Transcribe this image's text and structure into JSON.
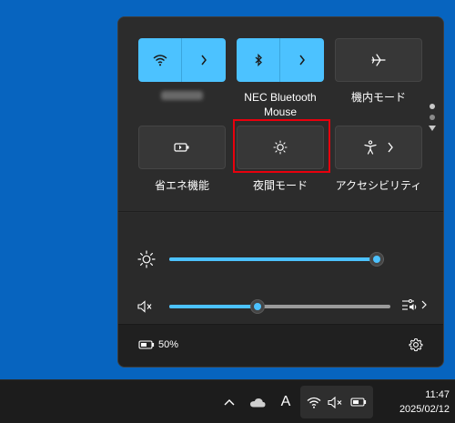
{
  "quick_settings": {
    "tiles_row1": [
      {
        "id": "wifi",
        "icon": "wifi-icon",
        "label": "",
        "active": true,
        "split": true
      },
      {
        "id": "bluetooth",
        "icon": "bluetooth-icon",
        "label": "NEC Bluetooth Mouse",
        "active": true,
        "split": true
      },
      {
        "id": "airplane",
        "icon": "airplane-icon",
        "label": "機内モード",
        "active": false,
        "split": false
      }
    ],
    "tiles_row2": [
      {
        "id": "battery-saver",
        "icon": "battery-saver-icon",
        "label": "省エネ機能",
        "active": false
      },
      {
        "id": "night-light",
        "icon": "night-light-icon",
        "label": "夜間モード",
        "active": false
      },
      {
        "id": "accessibility",
        "icon": "accessibility-icon",
        "label": "アクセシビリティ",
        "active": false
      }
    ],
    "brightness": {
      "icon": "brightness-icon",
      "level_percent": 100
    },
    "volume": {
      "icon": "speaker-muted-icon",
      "level_percent": 40,
      "muted": true
    },
    "footer": {
      "battery_text": "50%",
      "battery_icon": "battery-icon",
      "settings_icon": "gear-icon"
    }
  },
  "taskbar": {
    "chevron_icon": "chevron-up-icon",
    "cloud_icon": "onedrive-cloud-icon",
    "ime_label": "A",
    "status_icons": [
      "wifi-icon",
      "speaker-muted-icon",
      "battery-icon"
    ],
    "time": "11:47",
    "date": "2025/02/12"
  },
  "colors": {
    "desktop": "#0764bf",
    "accent": "#4cc2ff",
    "highlight_box": "#e8000d",
    "panel": "#2c2c2c",
    "taskbar": "#1c1c1c"
  }
}
